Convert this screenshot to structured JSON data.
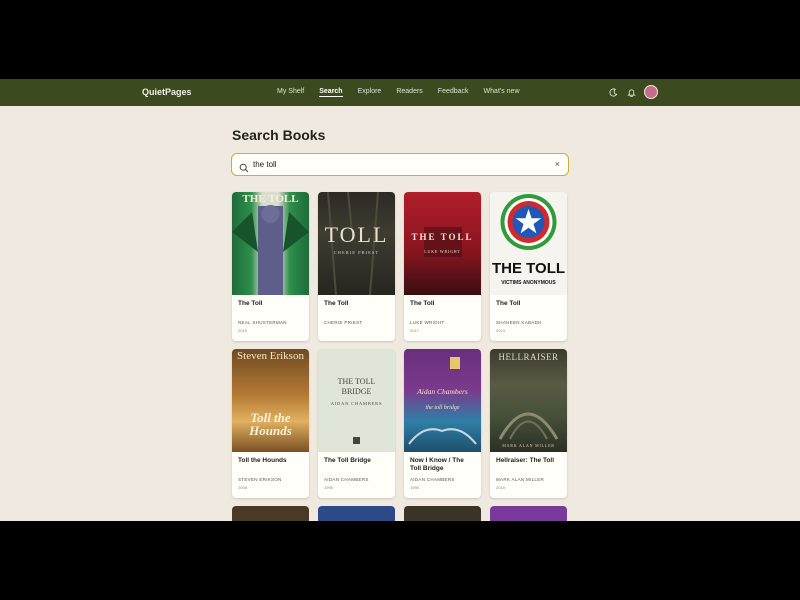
{
  "app": {
    "brand": "QuietPages"
  },
  "nav": [
    {
      "label": "My Shelf",
      "active": false
    },
    {
      "label": "Search",
      "active": true
    },
    {
      "label": "Explore",
      "active": false
    },
    {
      "label": "Readers",
      "active": false
    },
    {
      "label": "Feedback",
      "active": false
    },
    {
      "label": "What's new",
      "active": false
    }
  ],
  "icons": {
    "theme": "moon-icon",
    "notifications": "bell-icon",
    "avatar": "avatar"
  },
  "page": {
    "title": "Search Books"
  },
  "search": {
    "value": "the toll",
    "clear": "×"
  },
  "books": [
    {
      "title": "The Toll",
      "author": "NEAL SHUSTERMAN",
      "year": "2019",
      "cover_text": "THE TOLL",
      "cover_sub": ""
    },
    {
      "title": "The Toll",
      "author": "CHERIE PRIEST",
      "year": "",
      "cover_text": "TOLL",
      "cover_sub": "CHERIE PRIEST"
    },
    {
      "title": "The Toll",
      "author": "LUKE WRIGHT",
      "year": "2017",
      "cover_text": "THE TOLL",
      "cover_sub": "LUKE WRIGHT"
    },
    {
      "title": "The Toll",
      "author": "SHAHEEN KABADH",
      "year": "2014",
      "cover_text": "THE TOLL",
      "cover_sub": "VICTIMS ANONYMOUS"
    },
    {
      "title": "Toll the Hounds",
      "author": "STEVEN ERIKSON",
      "year": "2008",
      "cover_text": "Steven Erikson",
      "cover_sub": "Toll the Hounds"
    },
    {
      "title": "The Toll Bridge",
      "author": "AIDAN CHAMBERS",
      "year": "1995",
      "cover_text": "THE TOLL BRIDGE",
      "cover_sub": "AIDAN CHAMBERS"
    },
    {
      "title": "Now I Know / The Toll Bridge",
      "author": "AIDAN CHAMBERS",
      "year": "1995",
      "cover_text": "Aidan Chambers",
      "cover_sub": "the toll bridge"
    },
    {
      "title": "Hellraiser: The Toll",
      "author": "MARK ALAN MILLER",
      "year": "2018",
      "cover_text": "HELLRAISER",
      "cover_sub": "MARK ALAN MILLER"
    }
  ],
  "colors": {
    "topbar": "#3b4a1f",
    "background": "#efe9df",
    "search_border": "#c9ae3a"
  }
}
